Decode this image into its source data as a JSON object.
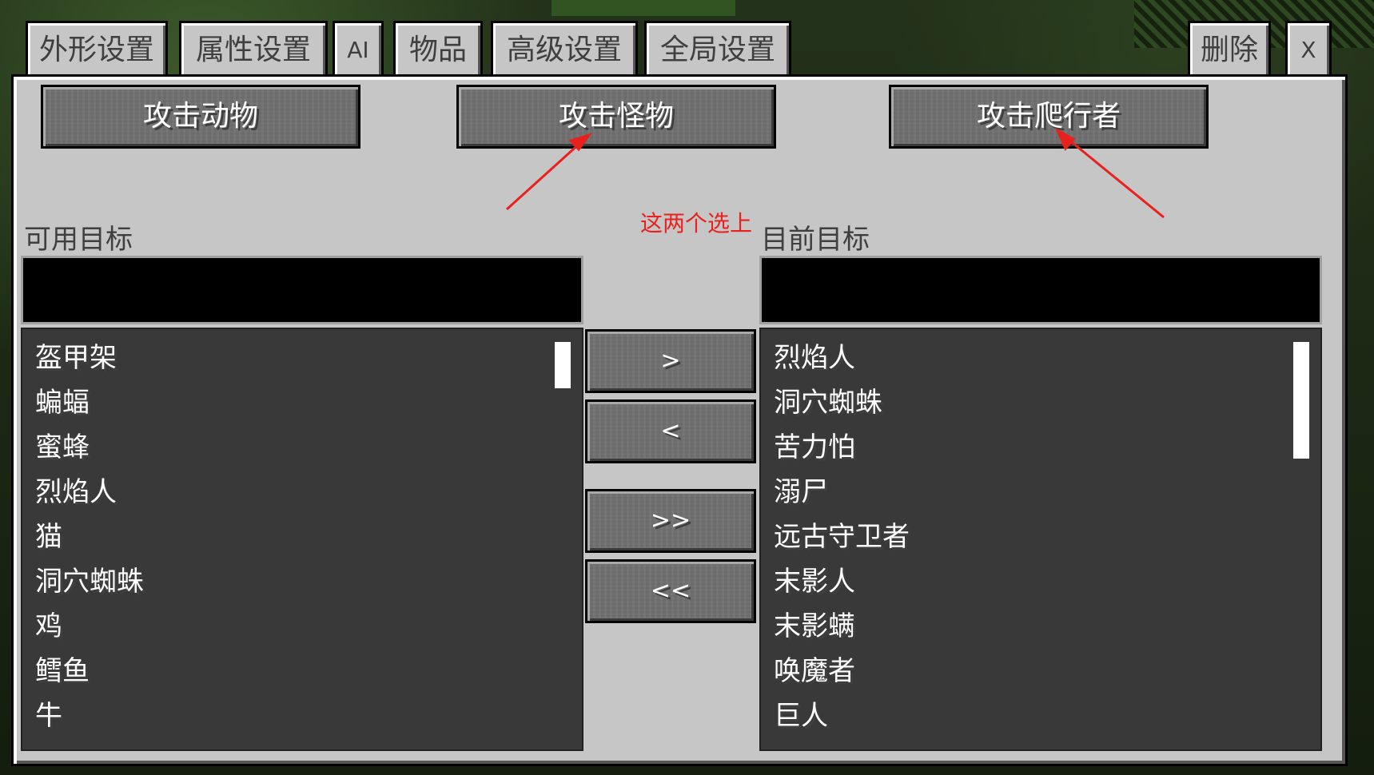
{
  "tabs": {
    "appearance": "外形设置",
    "attributes": "属性设置",
    "ai": "AI",
    "items": "物品",
    "advanced": "高级设置",
    "global": "全局设置",
    "delete": "删除",
    "close": "X"
  },
  "buttons": {
    "attack_animals": "攻击动物",
    "attack_monsters": "攻击怪物",
    "attack_creepers": "攻击爬行者",
    "move_right": ">",
    "move_left": "<",
    "move_all_right": ">>",
    "move_all_left": "<<"
  },
  "annotation": {
    "note": "这两个选上",
    "color": "#e8201e"
  },
  "available": {
    "label": "可用目标",
    "search_value": "",
    "items": [
      "盔甲架",
      "蝙蝠",
      "蜜蜂",
      "烈焰人",
      "猫",
      "洞穴蜘蛛",
      "鸡",
      "鳕鱼",
      "牛"
    ]
  },
  "current": {
    "label": "目前目标",
    "search_value": "",
    "items": [
      "烈焰人",
      "洞穴蜘蛛",
      "苦力怕",
      "溺尸",
      "远古守卫者",
      "末影人",
      "末影螨",
      "唤魔者",
      "巨人"
    ]
  }
}
